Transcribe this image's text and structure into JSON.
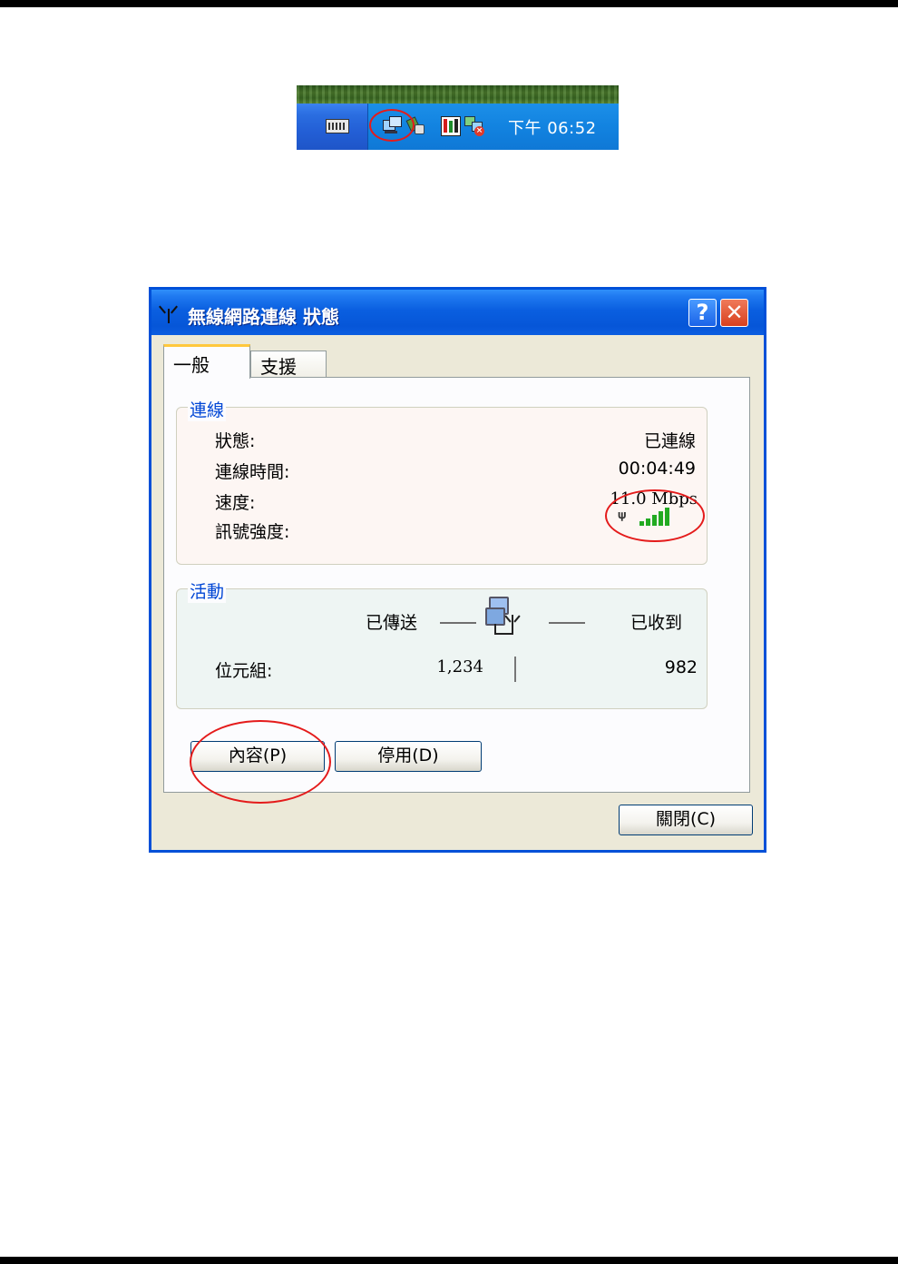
{
  "taskbar": {
    "clock": "下午 06:52",
    "icons": [
      "keyboard-icon",
      "network-connections-icon",
      "usb-device-icon",
      "levels-icon",
      "disconnected-network-icon"
    ]
  },
  "dialog": {
    "title": "無線網路連線 狀態",
    "help_button": "?",
    "close_button": "✕",
    "tabs": [
      {
        "label": "一般",
        "selected": true
      },
      {
        "label": "支援",
        "selected": false
      }
    ],
    "connection": {
      "legend": "連線",
      "status_label": "狀態:",
      "status_value": "已連線",
      "duration_label": "連線時間:",
      "duration_value": "00:04:49",
      "speed_label": "速度:",
      "speed_value": "11.0 Mbps",
      "signal_label": "訊號強度:",
      "signal_bars": 5
    },
    "activity": {
      "legend": "活動",
      "sent_label": "已傳送",
      "received_label": "已收到",
      "bytes_label": "位元組:",
      "bytes_sent": "1,234",
      "bytes_received": "982"
    },
    "buttons": {
      "properties": "內容(P)",
      "disable": "停用(D)",
      "close": "關閉(C)"
    }
  },
  "colors": {
    "highlight": "#e41b1b",
    "titlebar": "#0656d8",
    "legend_text": "#0046d5",
    "signal_green": "#22aa22"
  }
}
